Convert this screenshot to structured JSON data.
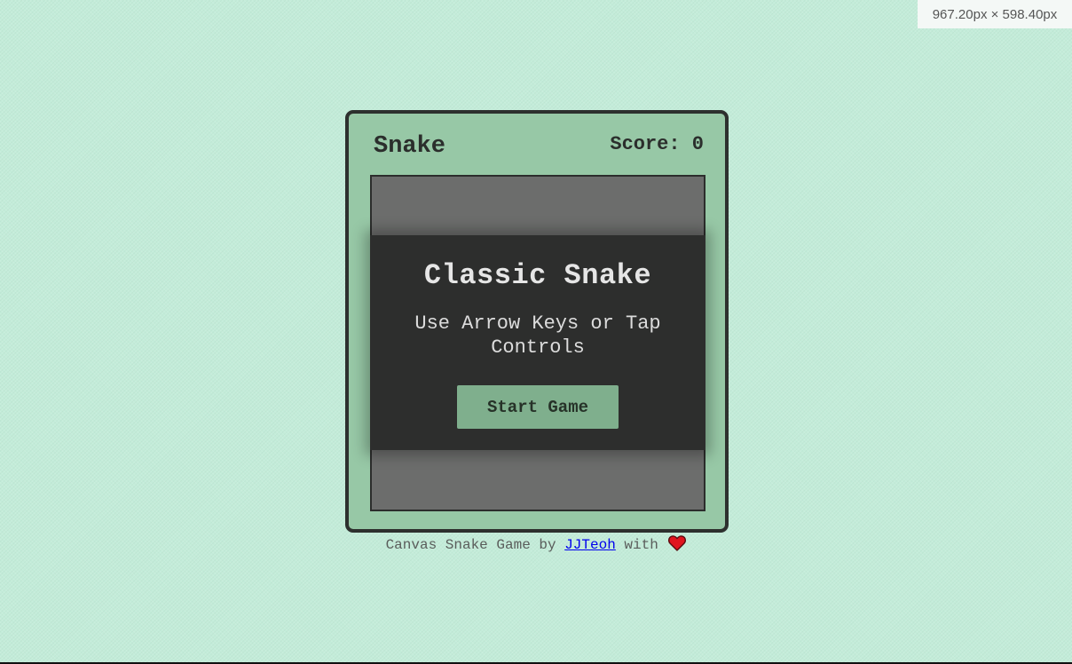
{
  "viewport_readout": "967.20px × 598.40px",
  "game": {
    "title": "Snake",
    "score_label": "Score: ",
    "score_value": "0"
  },
  "overlay": {
    "title": "Classic Snake",
    "subtitle": "Use Arrow Keys or Tap Controls",
    "start_label": "Start Game"
  },
  "footer": {
    "prefix": "Canvas Snake Game by ",
    "author": "JJTeoh",
    "suffix": " with ",
    "heart_icon": "heart-icon"
  },
  "colors": {
    "background": "#c3ecd9",
    "console_body": "#97c8a6",
    "console_border": "#2d302e",
    "board": "#6c6d6c",
    "overlay": "#2d2e2d",
    "button": "#7faf8d",
    "heart": "#e0141e",
    "link": "#0000ee"
  }
}
